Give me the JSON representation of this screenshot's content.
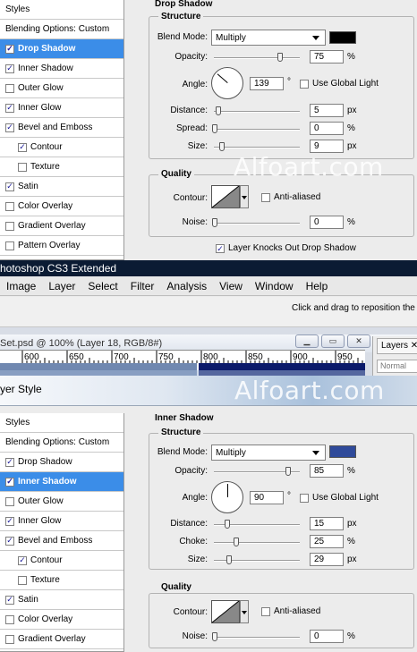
{
  "watermark": "Alfoart.com",
  "top": {
    "sidebar": [
      {
        "label": "Styles",
        "type": "header",
        "checked": false,
        "selected": false
      },
      {
        "label": "Blending Options: Custom",
        "type": "header",
        "checked": false,
        "selected": false
      },
      {
        "label": "Drop Shadow",
        "type": "item",
        "checked": true,
        "selected": true
      },
      {
        "label": "Inner Shadow",
        "type": "item",
        "checked": true,
        "selected": false
      },
      {
        "label": "Outer Glow",
        "type": "item",
        "checked": false,
        "selected": false
      },
      {
        "label": "Inner Glow",
        "type": "item",
        "checked": true,
        "selected": false
      },
      {
        "label": "Bevel and Emboss",
        "type": "item",
        "checked": true,
        "selected": false
      },
      {
        "label": "Contour",
        "type": "sub",
        "checked": true,
        "selected": false
      },
      {
        "label": "Texture",
        "type": "sub",
        "checked": false,
        "selected": false
      },
      {
        "label": "Satin",
        "type": "item",
        "checked": true,
        "selected": false
      },
      {
        "label": "Color Overlay",
        "type": "item",
        "checked": false,
        "selected": false
      },
      {
        "label": "Gradient Overlay",
        "type": "item",
        "checked": false,
        "selected": false
      },
      {
        "label": "Pattern Overlay",
        "type": "item",
        "checked": false,
        "selected": false
      }
    ],
    "panel_title": "Drop Shadow",
    "structure_label": "Structure",
    "blend_mode_label": "Blend Mode:",
    "blend_mode_value": "Multiply",
    "color": "#000000",
    "opacity_label": "Opacity:",
    "opacity_value": "75",
    "opacity_unit": "%",
    "angle_label": "Angle:",
    "angle_value": "139",
    "angle_unit": "°",
    "global_light_label": "Use Global Light",
    "distance_label": "Distance:",
    "distance_value": "5",
    "distance_unit": "px",
    "spread_label": "Spread:",
    "spread_value": "0",
    "spread_unit": "%",
    "size_label": "Size:",
    "size_value": "9",
    "size_unit": "px",
    "quality_label": "Quality",
    "contour_label": "Contour:",
    "antialiased_label": "Anti-aliased",
    "noise_label": "Noise:",
    "noise_value": "0",
    "noise_unit": "%",
    "knockout_label": "Layer Knocks Out Drop Shadow"
  },
  "app": {
    "title": "hotoshop CS3 Extended",
    "menus": [
      "Image",
      "Layer",
      "Select",
      "Filter",
      "Analysis",
      "View",
      "Window",
      "Help"
    ],
    "hint": "Click and drag to reposition the",
    "doc_title": "Set.psd @ 100% (Layer 18, RGB/8#)",
    "ruler_ticks": [
      "600",
      "650",
      "700",
      "750",
      "800",
      "850",
      "900",
      "950"
    ],
    "layers_tab": "Layers",
    "blend_normal": "Normal",
    "dialog_title": "yer Style"
  },
  "bottom": {
    "sidebar": [
      {
        "label": "Styles",
        "type": "header",
        "checked": false,
        "selected": false
      },
      {
        "label": "Blending Options: Custom",
        "type": "header",
        "checked": false,
        "selected": false
      },
      {
        "label": "Drop Shadow",
        "type": "item",
        "checked": true,
        "selected": false
      },
      {
        "label": "Inner Shadow",
        "type": "item",
        "checked": true,
        "selected": true
      },
      {
        "label": "Outer Glow",
        "type": "item",
        "checked": false,
        "selected": false
      },
      {
        "label": "Inner Glow",
        "type": "item",
        "checked": true,
        "selected": false
      },
      {
        "label": "Bevel and Emboss",
        "type": "item",
        "checked": true,
        "selected": false
      },
      {
        "label": "Contour",
        "type": "sub",
        "checked": true,
        "selected": false
      },
      {
        "label": "Texture",
        "type": "sub",
        "checked": false,
        "selected": false
      },
      {
        "label": "Satin",
        "type": "item",
        "checked": true,
        "selected": false
      },
      {
        "label": "Color Overlay",
        "type": "item",
        "checked": false,
        "selected": false
      },
      {
        "label": "Gradient Overlay",
        "type": "item",
        "checked": false,
        "selected": false
      }
    ],
    "panel_title": "Inner Shadow",
    "structure_label": "Structure",
    "blend_mode_label": "Blend Mode:",
    "blend_mode_value": "Multiply",
    "color": "#2f4a9a",
    "opacity_label": "Opacity:",
    "opacity_value": "85",
    "opacity_unit": "%",
    "angle_label": "Angle:",
    "angle_value": "90",
    "angle_unit": "°",
    "global_light_label": "Use Global Light",
    "distance_label": "Distance:",
    "distance_value": "15",
    "distance_unit": "px",
    "choke_label": "Choke:",
    "choke_value": "25",
    "choke_unit": "%",
    "size_label": "Size:",
    "size_value": "29",
    "size_unit": "px",
    "quality_label": "Quality",
    "contour_label": "Contour:",
    "antialiased_label": "Anti-aliased",
    "noise_label": "Noise:",
    "noise_value": "0",
    "noise_unit": "%"
  }
}
